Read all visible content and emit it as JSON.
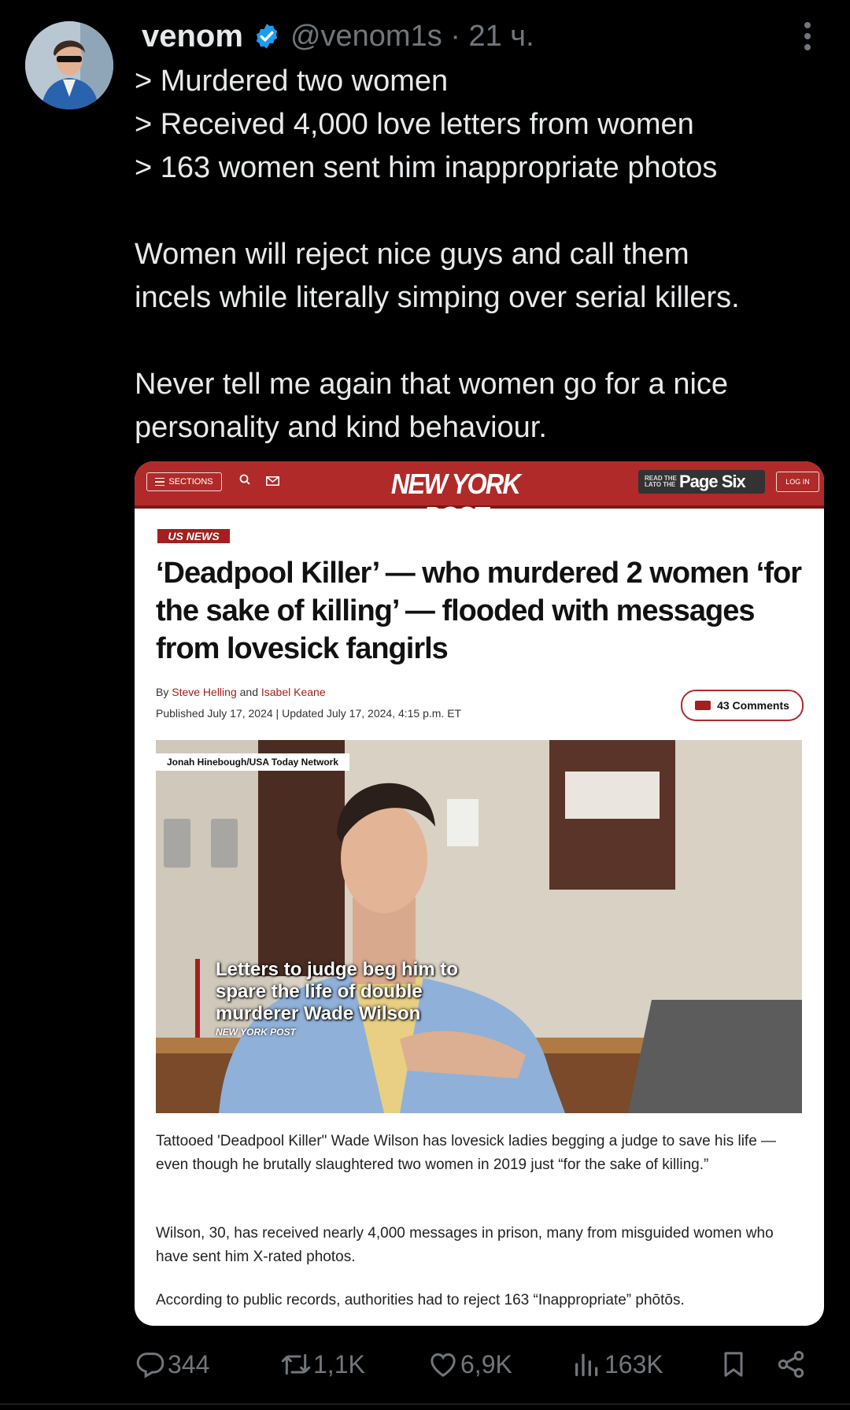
{
  "tweet": {
    "author_name": "venom",
    "handle_time": "@venom1s · 21 ч.",
    "text_lines": [
      "> Murdered two women",
      "> Received 4,000 love letters from women",
      "> 163 women sent him inappropriate photos",
      "",
      "Women will reject nice guys and call them",
      "incels while literally simping over serial killers.",
      "",
      "Never tell me again that women go for a nice",
      "personality and kind behaviour."
    ]
  },
  "card": {
    "nav": {
      "sections": "SECTIONS",
      "logo": "NEW YORK POST",
      "pagesix_small": "READ THE LATO THE",
      "pagesix": "Page Six",
      "login": "LOG IN"
    },
    "section_tag": "US NEWS",
    "headline": "‘Deadpool Killer’ — who murdered 2 women ‘for the sake of killing’ — flooded with messages from lovesick fangirls",
    "byline_prefix": "By ",
    "author1": "Steve Helling",
    "byline_and": " and ",
    "author2": "Isabel Keane",
    "published": "Published July 17, 2024  |  Updated July 17, 2024, 4:15 p.m. ET",
    "comments": "43 Comments",
    "photo_credit": "Jonah Hinebough/USA Today Network",
    "photo_caption": "Letters to judge beg him to spare the life of double murderer Wade Wilson",
    "photo_source": "NEW YORK POST",
    "paragraphs": [
      "Tattooed 'Deadpool Killer\" Wade Wilson has lovesick ladies begging a judge to save his life — even though he brutally slaughtered two women in 2019 just “for the sake of killing.”",
      "Wilson, 30, has received nearly 4,000 messages in prison, many from misguided women who have sent him X-rated photos.",
      "According to public records, authorities  had to reject 163 “Inappropriate” phōtōs."
    ]
  },
  "actions": {
    "replies": "344",
    "reposts": "1,1K",
    "likes": "6,9K",
    "views": "163K"
  },
  "colors": {
    "accent": "#1d9bf0",
    "nyp_red": "#b02a2a",
    "muted": "#71767b"
  }
}
